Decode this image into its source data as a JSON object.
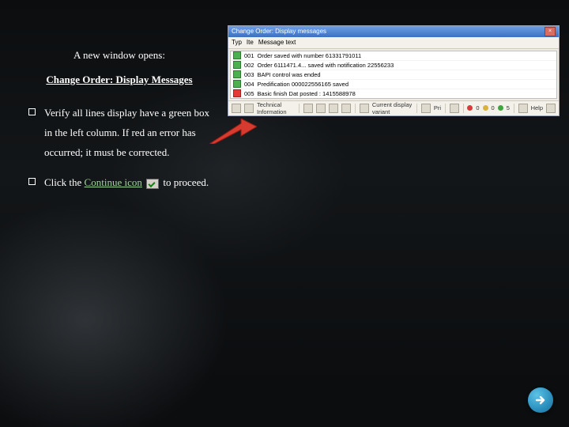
{
  "slide": {
    "intro": "A new window opens:",
    "title": "Change Order: Display Messages",
    "bullets": [
      "Verify all lines display have a green box in the left column. If red an error has occurred; it must be corrected.",
      "Click the Continue icon        to proceed."
    ],
    "continue_label": "Continue icon"
  },
  "screenshot": {
    "window_title": "Change Order: Display messages",
    "header_cols": [
      "Typ",
      "Ite",
      "Message text"
    ],
    "rows": [
      {
        "status": "green",
        "id": "001",
        "text": "Order saved with number 61331791011"
      },
      {
        "status": "green",
        "id": "002",
        "text": "Order 6111471.4... saved with notification 22556233"
      },
      {
        "status": "green",
        "id": "003",
        "text": "BAPI control was ended"
      },
      {
        "status": "green",
        "id": "004",
        "text": "Predification 000022556165 saved"
      },
      {
        "status": "red",
        "id": "005",
        "text": "Basic finish Dat posted : 1415588978"
      }
    ],
    "toolbar": {
      "tech_info": "Technical Information",
      "current_display": "Current display variant",
      "print": "Pri",
      "counts": {
        "red": "0",
        "yellow": "0",
        "green": "5"
      },
      "help": "Help"
    }
  }
}
